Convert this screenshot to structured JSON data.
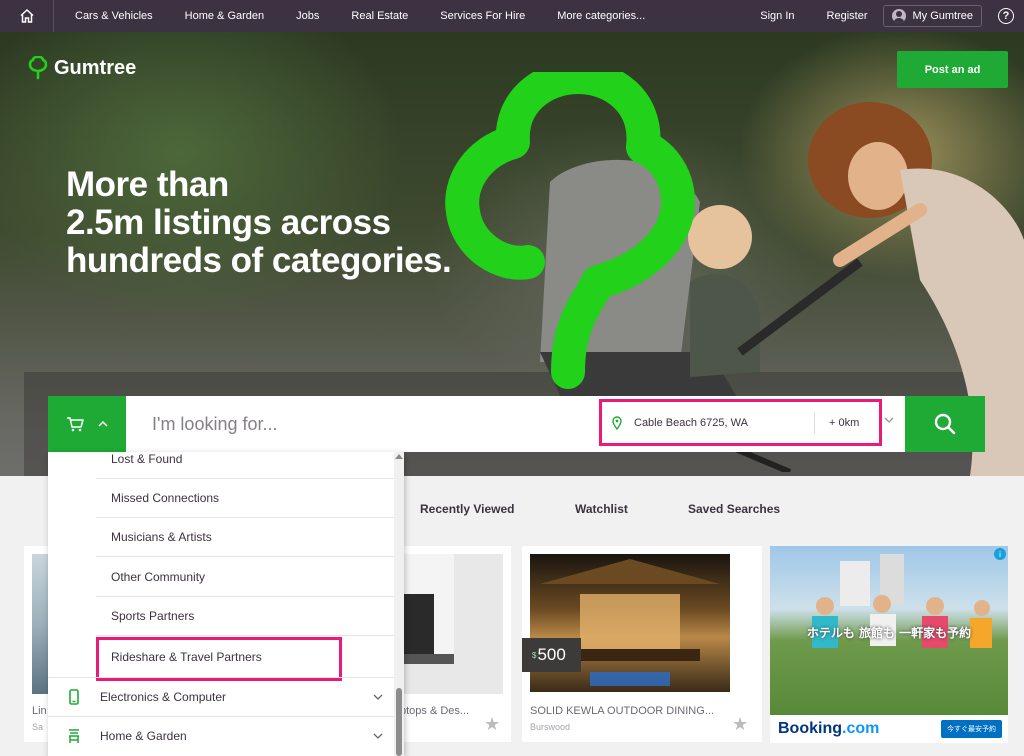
{
  "nav": {
    "links": [
      "Cars & Vehicles",
      "Home & Garden",
      "Jobs",
      "Real Estate",
      "Services For Hire",
      "More categories..."
    ],
    "sign_in": "Sign In",
    "register": "Register",
    "my_gumtree": "My Gumtree",
    "help_glyph": "?"
  },
  "brand": {
    "name": "Gumtree",
    "color": "#1eaa35"
  },
  "hero": {
    "post_ad": "Post an ad",
    "headline": [
      "More than",
      "2.5m listings across",
      "hundreds of categories."
    ]
  },
  "search": {
    "placeholder": "I'm looking for...",
    "location": "Cable Beach 6725, WA",
    "radius": "+ 0km"
  },
  "tabs": [
    "Recently Viewed",
    "Watchlist",
    "Saved Searches"
  ],
  "dropdown": {
    "sub_items": [
      "Lost & Found",
      "Missed Connections",
      "Musicians & Artists",
      "Other Community",
      "Sports Partners",
      "Rideshare & Travel Partners"
    ],
    "categories": [
      {
        "label": "Electronics & Computer",
        "icon": "phone-icon"
      },
      {
        "label": "Home & Garden",
        "icon": "garden-chair-icon"
      }
    ]
  },
  "cards": [
    {
      "title": "Lin",
      "sub": "Sa"
    },
    {
      "title": "ptops & Des...",
      "sub": ""
    },
    {
      "title": "SOLID KEWLA OUTDOOR DINING...",
      "sub": "Burswood",
      "price_symbol": "$",
      "price": "500"
    }
  ],
  "ad": {
    "japanese": "ホテルも 旅館も 一軒家も予約",
    "brand_main": "Booking",
    "brand_tld": ".com",
    "cta": "今すぐ最安予約",
    "badge": "i"
  },
  "colors": {
    "nav_bg": "#3c3241",
    "green": "#1eaa35",
    "highlight": "#ea1a79"
  }
}
